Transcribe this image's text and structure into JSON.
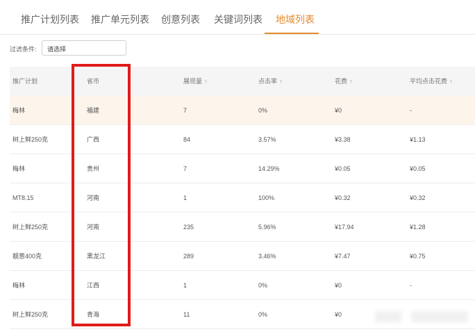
{
  "tabs": [
    {
      "label": "推广计划列表",
      "active": false
    },
    {
      "label": "推广单元列表",
      "active": false
    },
    {
      "label": "创意列表",
      "active": false
    },
    {
      "label": "关键词列表",
      "active": false
    },
    {
      "label": "地域列表",
      "active": true
    }
  ],
  "filter": {
    "label": "过滤条件:",
    "value": "请选择"
  },
  "table": {
    "headers": [
      {
        "label": "推广计划",
        "sort_icon": ""
      },
      {
        "label": "省市",
        "sort_icon": ""
      },
      {
        "label": "展现量",
        "sort_icon": "↑"
      },
      {
        "label": "点击率",
        "sort_icon": "↑"
      },
      {
        "label": "花费",
        "sort_icon": "↑"
      },
      {
        "label": "平均点击花费",
        "sort_icon": "↑"
      }
    ],
    "rows": [
      [
        "梅林",
        "福建",
        "7",
        "0%",
        "¥0",
        "-"
      ],
      [
        "树上鲜250克",
        "广西",
        "84",
        "3.57%",
        "¥3.38",
        "¥1.13"
      ],
      [
        "梅林",
        "贵州",
        "7",
        "14.29%",
        "¥0.05",
        "¥0.05"
      ],
      [
        "MT8.15",
        "河南",
        "1",
        "100%",
        "¥0.32",
        "¥0.32"
      ],
      [
        "树上鲜250克",
        "河南",
        "235",
        "5.96%",
        "¥17.94",
        "¥1.28"
      ],
      [
        "靓葱400克",
        "黑龙江",
        "289",
        "3.46%",
        "¥7.47",
        "¥0.75"
      ],
      [
        "梅林",
        "江西",
        "1",
        "0%",
        "¥0",
        "-"
      ],
      [
        "树上鲜250克",
        "青海",
        "11",
        "0%",
        "¥0",
        ""
      ]
    ]
  },
  "colors": {
    "accent": "#e38b2f",
    "highlight_box": "#e01b1b",
    "row_highlight": "#fdf5ec",
    "header_bg": "#f5f5f5"
  }
}
